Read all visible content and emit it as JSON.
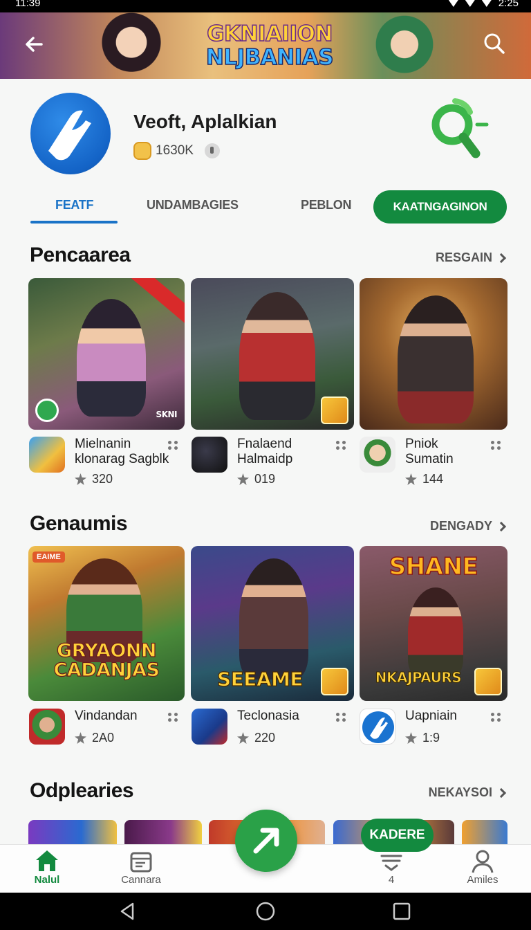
{
  "status_bar": {
    "time": "11:39",
    "right_time": "2:25"
  },
  "banner": {
    "logo_line1": "GKNIAIION",
    "logo_line2": "NLJBANIAS"
  },
  "app": {
    "title": "Veoft, Aplalkian",
    "count": "1630K"
  },
  "tabs": [
    {
      "label": "FEATF",
      "active": true
    },
    {
      "label": "UNDAMBAGIES",
      "active": false
    },
    {
      "label": "PEBLON",
      "active": false
    },
    {
      "label": "KAATNGAGINON",
      "active": false
    }
  ],
  "sections": [
    {
      "title": "Pencaarea",
      "more": "RESGAIN",
      "items": [
        {
          "name_line1": "Mielnanin",
          "name_line2": "klonarag Sagblk",
          "rating": "320"
        },
        {
          "name_line1": "Fnalaend",
          "name_line2": "Halmaidp",
          "rating": "019"
        },
        {
          "name_line1": "Pniok",
          "name_line2": "Sumatin",
          "rating": "144"
        }
      ],
      "card_labels": [
        "SKNI"
      ]
    },
    {
      "title": "Genaumis",
      "more": "DENGADY",
      "items": [
        {
          "name_line1": "Vindandan",
          "rating": "2A0"
        },
        {
          "name_line1": "Teclonasia",
          "rating": "220"
        },
        {
          "name_line1": "Uapniain",
          "rating": "1:9"
        }
      ],
      "card_labels": [
        "EAIME",
        "GRYAONN CADANJAS",
        "SEEAME",
        "SHANE",
        "NKAJPAURS"
      ]
    },
    {
      "title": "Odplearies",
      "more": "NEKAYSOI"
    }
  ],
  "pill_button": "KADERE",
  "bottom_nav": [
    {
      "label": "Nalul",
      "icon": "home-icon",
      "active": true
    },
    {
      "label": "Cannara",
      "icon": "folder-icon",
      "active": false
    },
    {
      "label": "4",
      "icon": "inbox-icon",
      "active": false
    },
    {
      "label": "Amiles",
      "icon": "person-icon",
      "active": false
    }
  ],
  "colors": {
    "accent_green": "#138a3f",
    "accent_blue": "#1a73c7",
    "fab_green": "#2aa148"
  }
}
